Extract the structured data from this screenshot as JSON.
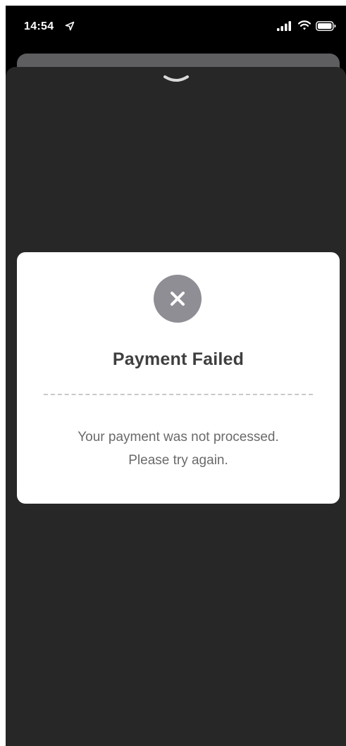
{
  "status_bar": {
    "time": "14:54",
    "icons": [
      "location-arrow-icon",
      "cellular-signal-icon",
      "wifi-icon",
      "battery-icon"
    ]
  },
  "sheet": {
    "handle_icon": "chevron-down-icon",
    "background_color": "#272727"
  },
  "dialog": {
    "status_icon": "close-icon",
    "status_color": "#8f8e94",
    "title": "Payment Failed",
    "message_line1": "Your payment was not processed.",
    "message_line2": "Please try again."
  }
}
